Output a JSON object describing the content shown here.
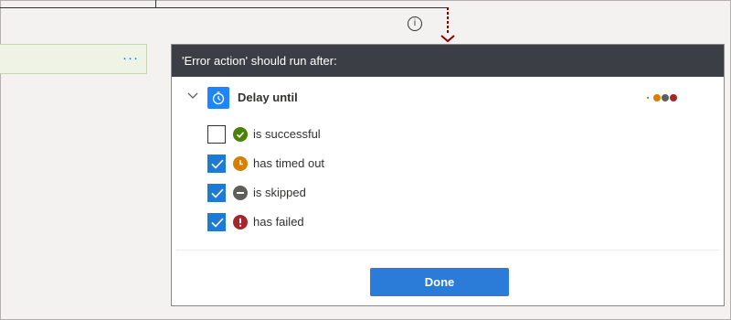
{
  "canvas": {
    "info_icon_glyph": "i",
    "left_card": {
      "more_label": "···"
    }
  },
  "panel": {
    "title": "'Error action' should run after:",
    "action": {
      "name": "Delay until",
      "icon": "timer-icon"
    },
    "options": [
      {
        "label": "is successful",
        "checked": false,
        "icon": "check-circle-icon",
        "color": "#498205"
      },
      {
        "label": "has timed out",
        "checked": true,
        "icon": "clock-icon",
        "color": "#d67f00"
      },
      {
        "label": "is skipped",
        "checked": true,
        "icon": "minus-circle-icon",
        "color": "#605e5c"
      },
      {
        "label": "has failed",
        "checked": true,
        "icon": "exclamation-circle-icon",
        "color": "#a4262c"
      }
    ],
    "status_dot_colors": [
      "#498205",
      "#d67f00",
      "#605e5c",
      "#a4262c"
    ],
    "done_label": "Done"
  },
  "colors": {
    "header_bg": "#3b3f45",
    "accent": "#2b7cd8",
    "connector": "#8b0000"
  }
}
